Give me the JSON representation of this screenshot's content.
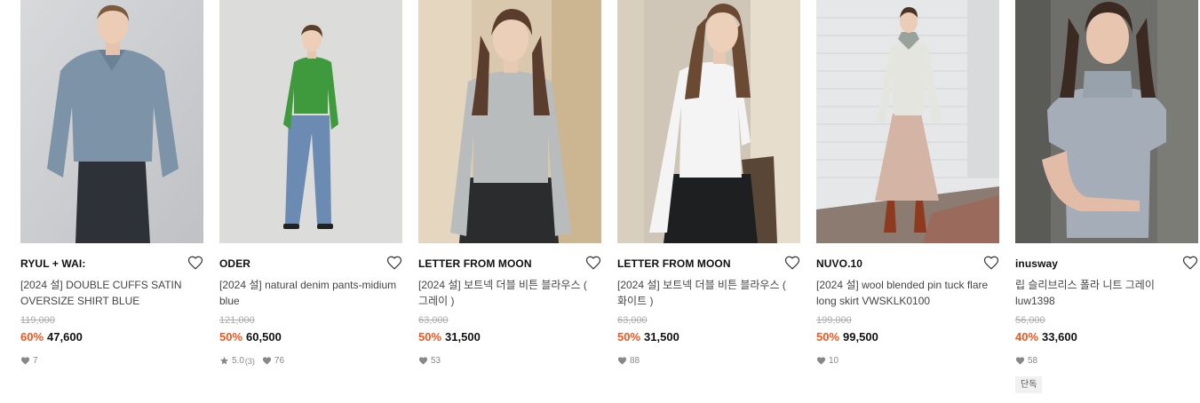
{
  "accent_color": "#f3551d",
  "products": [
    {
      "brand": "RYUL + WAI:",
      "title": "[2024 설] DOUBLE CUFFS SATIN OVERSIZE SHIRT BLUE",
      "original_price": "119,000",
      "discount": "60%",
      "price": "47,600",
      "likes": "7",
      "image": "model in blue satin oversize shirt and dark jeans"
    },
    {
      "brand": "ODER",
      "title": "[2024 설] natural denim pants-midium blue",
      "original_price": "121,000",
      "discount": "50%",
      "price": "60,500",
      "rating": "5.0",
      "reviews": "(3)",
      "likes": "76",
      "image": "model in green sweater and blue denim pants"
    },
    {
      "brand": "LETTER FROM MOON",
      "title": "[2024 설] 보트넥 더블 비튼 블라우스 ( 그레이 )",
      "original_price": "63,000",
      "discount": "50%",
      "price": "31,500",
      "likes": "53",
      "image": "model in grey boat-neck blouse"
    },
    {
      "brand": "LETTER FROM MOON",
      "title": "[2024 설] 보트넥 더블 비튼 블라우스 ( 화이트 )",
      "original_price": "63,000",
      "discount": "50%",
      "price": "31,500",
      "likes": "88",
      "image": "model in white boat-neck blouse"
    },
    {
      "brand": "NUVO.10",
      "title": "[2024 설] wool blended pin tuck flare long skirt VWSKLK0100",
      "original_price": "199,000",
      "discount": "50%",
      "price": "99,500",
      "likes": "10",
      "image": "model in beige pin tuck flare long skirt"
    },
    {
      "brand": "inusway",
      "title": "립 슬리브리스 폴라 니트 그레이 luw1398",
      "original_price": "56,000",
      "discount": "40%",
      "price": "33,600",
      "likes": "58",
      "tag": "단독",
      "image": "model in grey ribbed sleeveless turtleneck knit"
    }
  ]
}
